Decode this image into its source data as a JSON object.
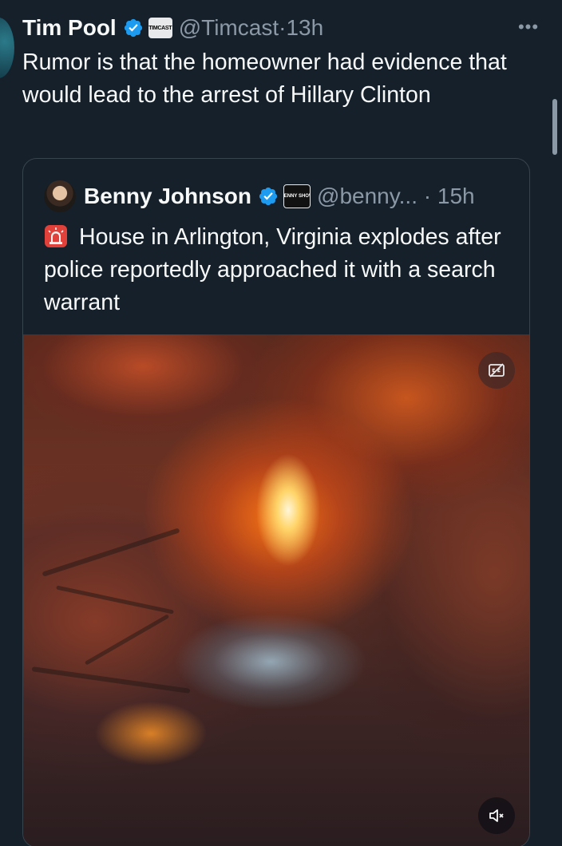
{
  "tweet": {
    "author_name": "Tim Pool",
    "affiliate_badge_text": "TIMCAST",
    "handle": "@Timcast",
    "separator": "·",
    "time": "13h",
    "more_label": "•••",
    "text": "Rumor is that the homeowner had evidence that would lead to the arrest of Hillary Clinton"
  },
  "quote": {
    "author_name": "Benny Johnson",
    "affiliate_badge_text": "BENNY SHOW",
    "handle": "@benny...",
    "separator": "·",
    "time": "15h",
    "text": "House in Arlington, Virginia explodes after police reportedly approached it with a search warrant",
    "emoji_icon": "police-siren-icon"
  },
  "media": {
    "type": "video",
    "captions_icon": "captions-off-icon",
    "mute_icon": "volume-muted-icon"
  },
  "colors": {
    "background": "#15202b",
    "text_primary": "#f7f9f9",
    "text_secondary": "#8b98a5",
    "verified_blue": "#1d9bf0",
    "card_border": "#38444d"
  }
}
